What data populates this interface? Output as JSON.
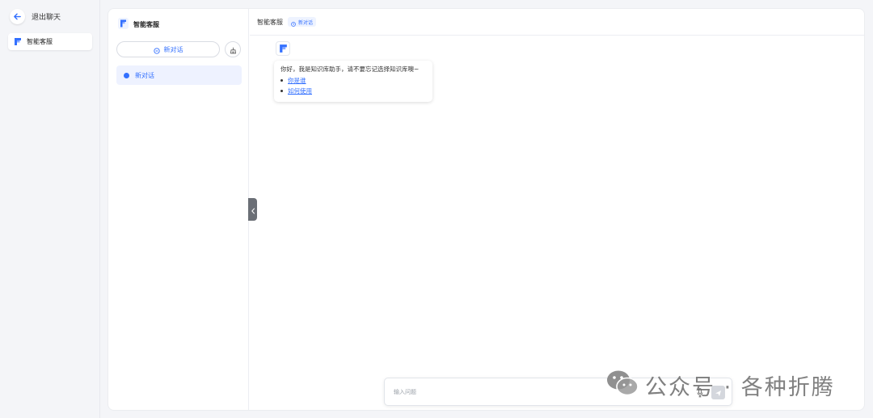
{
  "outer_sidebar": {
    "exit_label": "退出聊天",
    "app_item_label": "智能客服"
  },
  "history_panel": {
    "title": "智能客服",
    "new_chat_label": "新对话",
    "items": [
      {
        "label": "新对话"
      }
    ]
  },
  "chat": {
    "header_title": "智能客服",
    "header_badge": "新对话",
    "welcome_text": "你好，我是知识库助手，请不要忘记选择知识库噢~",
    "suggestions": [
      "你是谁",
      "如何使用"
    ],
    "input_placeholder": "输入问题"
  },
  "watermark": {
    "text": "公众号 · 各种折腾"
  },
  "colors": {
    "accent": "#3370ff",
    "background": "#f4f5f8"
  }
}
